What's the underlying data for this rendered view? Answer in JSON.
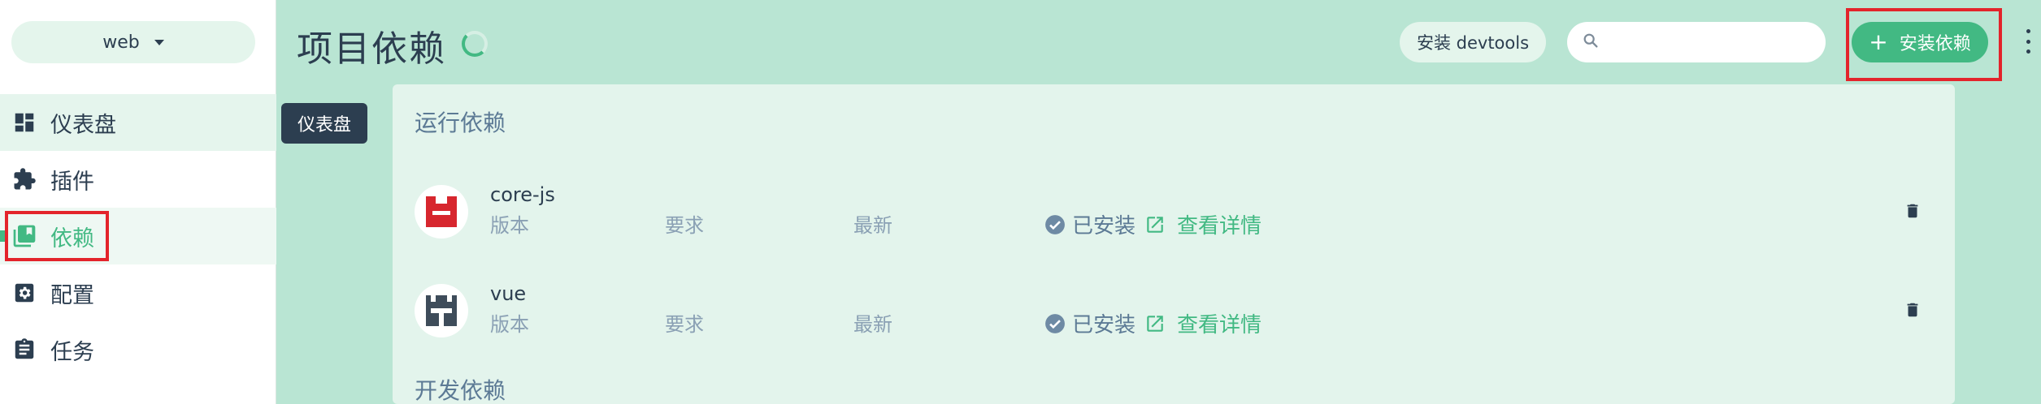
{
  "sidebar": {
    "project": "web",
    "items": [
      {
        "label": "仪表盘",
        "icon": "dashboard-icon"
      },
      {
        "label": "插件",
        "icon": "puzzle-icon"
      },
      {
        "label": "依赖",
        "icon": "library-icon"
      },
      {
        "label": "配置",
        "icon": "gear-icon"
      },
      {
        "label": "任务",
        "icon": "clipboard-icon"
      }
    ]
  },
  "tooltip": "仪表盘",
  "header": {
    "title": "项目依赖",
    "devtools_button": "安装 devtools",
    "search_placeholder": "",
    "install_button": "安装依赖"
  },
  "main": {
    "runtime_title": "运行依赖",
    "dev_title": "开发依赖",
    "dependencies": [
      {
        "name": "core-js",
        "version_label": "版本",
        "wanted_label": "要求",
        "latest_label": "最新",
        "status": "已安装",
        "details": "查看详情"
      },
      {
        "name": "vue",
        "version_label": "版本",
        "wanted_label": "要求",
        "latest_label": "最新",
        "status": "已安装",
        "details": "查看详情"
      }
    ]
  },
  "colors": {
    "accent": "#42b983",
    "text": "#2c3e50",
    "muted": "#8aa0b4",
    "background": "#b9e5d3",
    "panel": "#e3f4ec",
    "highlight_box": "#e3242b"
  }
}
